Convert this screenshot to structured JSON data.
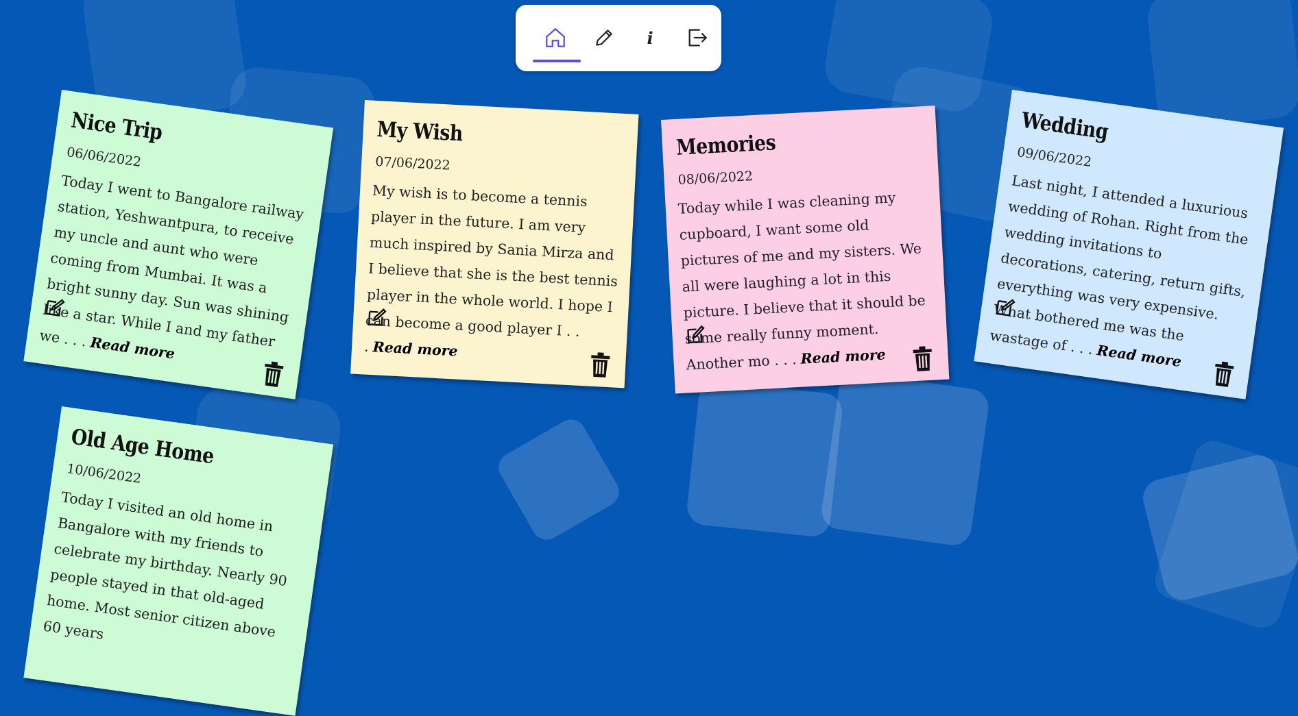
{
  "nav": {
    "items": [
      {
        "icon": "home-icon",
        "label": "Home",
        "active": true
      },
      {
        "icon": "pencil-icon",
        "label": "Write"
      },
      {
        "icon": "info-icon",
        "label": "i"
      },
      {
        "icon": "logout-icon",
        "label": "Logout"
      }
    ]
  },
  "notes": [
    {
      "title": "Nice Trip",
      "date": "06/06/2022",
      "body": "Today I went to Bangalore railway station, Yeshwantpura, to receive my uncle and aunt who were coming from Mumbai. It was a bright sunny day. Sun was shining like a star. While I and my father we . . .",
      "read_more": "Read more",
      "color": "#ccfbd6"
    },
    {
      "title": "My Wish",
      "date": "07/06/2022",
      "body": "My wish is to become a tennis player in the future. I am very much inspired by Sania Mirza and I believe that she is the best tennis player in the whole world. I hope I can become a good player I . . .",
      "read_more": "Read more",
      "color": "#fcf3cf"
    },
    {
      "title": "Memories",
      "date": "08/06/2022",
      "body": "Today while I was cleaning my cupboard, I want some old pictures of me and my sisters. We all were laughing a lot in this picture. I believe that it should be some really funny moment. Another mo . . .",
      "read_more": "Read more",
      "color": "#fccfe4"
    },
    {
      "title": "Wedding",
      "date": "09/06/2022",
      "body": "Last night, I attended a luxurious wedding of Rohan. Right from the wedding invitations to decorations, catering, return gifts, everything was very expensive. What bothered me was the wastage of . . .",
      "read_more": "Read more",
      "color": "#cfe8fd"
    },
    {
      "title": "Old Age Home",
      "date": "10/06/2022",
      "body": "Today I visited an old home in Bangalore with my friends to celebrate my birthday. Nearly 90 people stayed in that old-aged home. Most senior citizen above 60 years",
      "read_more": "",
      "color": "#ccfbd6"
    }
  ]
}
